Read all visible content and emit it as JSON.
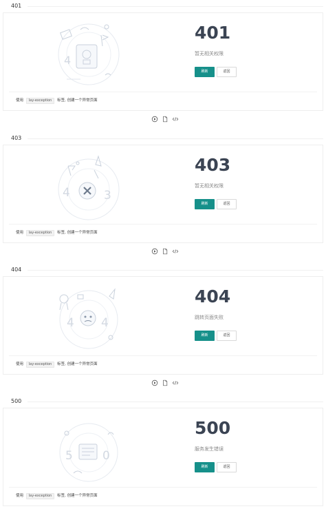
{
  "sections": [
    {
      "title": "401",
      "code": "401",
      "desc": "暂无相关权限",
      "refresh": "刷新",
      "back": "返回",
      "tip_prefix": "使用",
      "tip_tag": "lay-exception",
      "tip_suffix": "标签, 创建一个异常页面"
    },
    {
      "title": "403",
      "code": "403",
      "desc": "暂无相关权限",
      "refresh": "刷新",
      "back": "返回",
      "tip_prefix": "使用",
      "tip_tag": "lay-exception",
      "tip_suffix": "标签, 创建一个异常页面"
    },
    {
      "title": "404",
      "code": "404",
      "desc": "跳转页面失败",
      "refresh": "刷新",
      "back": "返回",
      "tip_prefix": "使用",
      "tip_tag": "lay-exception",
      "tip_suffix": "标签, 创建一个异常页面"
    },
    {
      "title": "500",
      "code": "500",
      "desc": "服务发生错误",
      "refresh": "刷新",
      "back": "返回",
      "tip_prefix": "使用",
      "tip_tag": "lay-exception",
      "tip_suffix": "标签, 创建一个异常页面"
    }
  ],
  "toolbar_icons": [
    "play-icon",
    "document-icon",
    "code-icon"
  ],
  "colors": {
    "primary": "#16908a",
    "heading": "#3b4453",
    "illustration": "#c9d1dc"
  }
}
